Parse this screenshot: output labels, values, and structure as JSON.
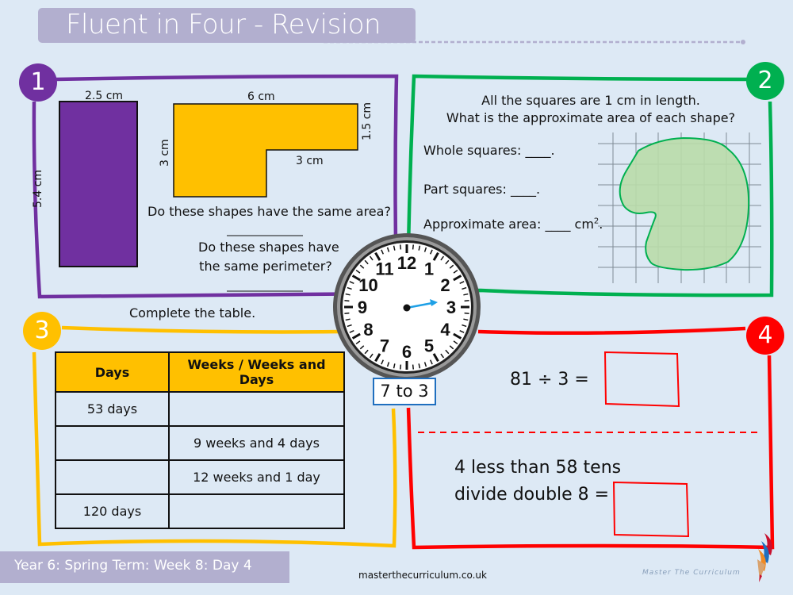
{
  "header": {
    "title": "Fluent in Four - Revision"
  },
  "colors": {
    "background": "#dde9f5",
    "title_bar": "#b2afcf",
    "section1": "#7030a0",
    "section2": "#00b050",
    "section3": "#ffc000",
    "section4": "#ff0000",
    "clock_label_border": "#1f6fbf",
    "clock_hand": "#1ea0e6",
    "shape_fill": "#b9dcaa"
  },
  "sections": {
    "q1": {
      "number": "1",
      "rect_width_label": "2.5 cm",
      "rect_height_label": "5.4 cm",
      "lshape_top_label": "6 cm",
      "lshape_right_label": "1.5 cm",
      "lshape_left_label": "3 cm",
      "lshape_inner_label": "3 cm",
      "question_area": "Do these shapes have the same area?",
      "question_perimeter_line1": "Do these shapes have",
      "question_perimeter_line2": "the same perimeter?"
    },
    "q2": {
      "number": "2",
      "line1": "All the squares are 1 cm in length.",
      "line2": "What is the approximate area of each shape?",
      "whole": "Whole squares: ____.",
      "part": "Part squares: ____.",
      "approx": "Approximate area: ____ cm",
      "approx_sup": "2",
      "approx_end": "."
    },
    "q3": {
      "number": "3",
      "instruction": "Complete the table.",
      "table": {
        "headers": [
          "Days",
          "Weeks / Weeks and Days"
        ],
        "rows": [
          [
            "53 days",
            ""
          ],
          [
            "",
            "9 weeks and 4 days"
          ],
          [
            "",
            "12 weeks and 1 day"
          ],
          [
            "120 days",
            ""
          ]
        ]
      }
    },
    "q4": {
      "number": "4",
      "eq1": "81 ÷ 3 =",
      "eq2_line1": "4 less than 58 tens",
      "eq2_line2": "divide double 8 ="
    }
  },
  "clock": {
    "numbers": [
      "12",
      "1",
      "2",
      "3",
      "4",
      "5",
      "6",
      "7",
      "8",
      "9",
      "10",
      "11"
    ],
    "label": "7 to 3"
  },
  "footer": {
    "lesson": "Year 6: Spring Term: Week 8: Day  4",
    "site": "masterthecurriculum.co.uk",
    "brand": "Master  The  Curriculum"
  }
}
